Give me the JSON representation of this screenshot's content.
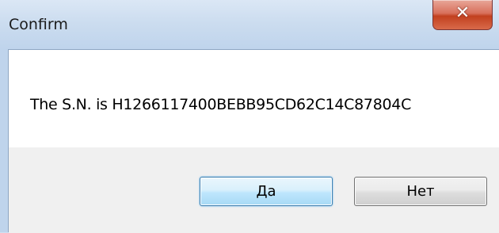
{
  "window": {
    "title": "Confirm",
    "close_glyph": "✕"
  },
  "message": {
    "text": "The S.N. is H1266117400BEBB95CD62C14C87804C"
  },
  "buttons": {
    "yes_label": "Да",
    "no_label": "Нет"
  },
  "colors": {
    "close_button": "#c2401f",
    "default_button_border": "#3c7fb1",
    "button_area_bg": "#f0f0f0"
  },
  "icons": [
    "close-icon"
  ]
}
